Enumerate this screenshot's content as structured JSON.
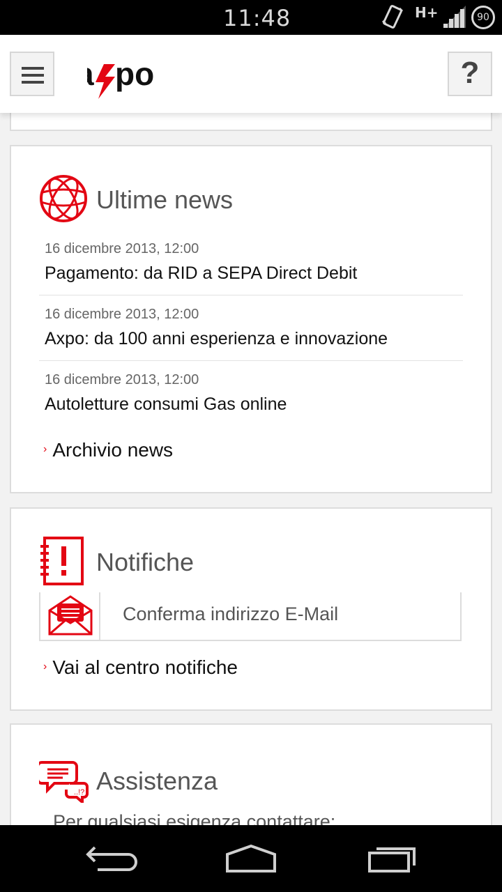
{
  "status_bar": {
    "time": "11:48",
    "network": "H+",
    "battery": "90",
    "icons": [
      "vibrate-icon",
      "signal-icon",
      "battery-icon"
    ]
  },
  "header": {
    "logo_text": "axpo",
    "menu_icon": "hamburger-menu-icon",
    "help_label": "?"
  },
  "colors": {
    "brand_red": "#e30613",
    "text_dark": "#111111",
    "text_muted": "#555555",
    "border": "#dcdcdc"
  },
  "news": {
    "title": "Ultime news",
    "icon": "globe-icon",
    "items": [
      {
        "date": "16 dicembre 2013, 12:00",
        "title": "Pagamento: da RID a SEPA Direct Debit"
      },
      {
        "date": "16 dicembre 2013, 12:00",
        "title": "Axpo: da 100 anni esperienza e innovazione"
      },
      {
        "date": "16 dicembre 2013, 12:00",
        "title": "Autoletture consumi Gas online"
      }
    ],
    "archive_link": "Archivio news"
  },
  "notifications": {
    "title": "Notifiche",
    "icon": "notification-alert-icon",
    "items": [
      {
        "icon": "envelope-icon",
        "text": "Conferma indirizzo E-Mail"
      }
    ],
    "center_link": "Vai al centro notifiche"
  },
  "assistance": {
    "title": "Assistenza",
    "icon": "chat-bubbles-icon",
    "text": "Per qualsiasi esigenza contattare:"
  },
  "nav_bar": {
    "icons": [
      "back-icon",
      "home-icon",
      "recent-apps-icon"
    ]
  }
}
